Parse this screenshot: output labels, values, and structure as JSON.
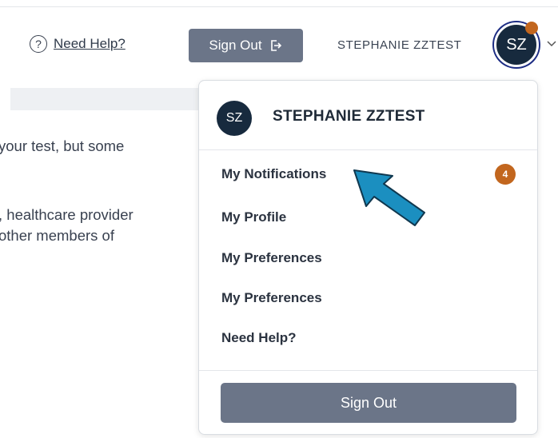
{
  "header": {
    "help_icon": "question-circle-icon",
    "help_label": "Need Help?",
    "signout_label": "Sign Out",
    "signout_icon": "sign-out-icon",
    "user_name": "STEPHANIE ZZTEST",
    "avatar_initials": "SZ",
    "avatar_notification_color": "#c2661e",
    "chevron_icon": "chevron-down-icon"
  },
  "background": {
    "lines": [
      "your test, but some",
      ", healthcare provider",
      "other members of"
    ]
  },
  "dropdown": {
    "avatar_initials": "SZ",
    "user_name": "STEPHANIE ZZTEST",
    "items": [
      {
        "label": "My Notifications",
        "badge": "4"
      },
      {
        "label": "My Profile"
      },
      {
        "label": "My Preferences"
      },
      {
        "label": "My Preferences"
      },
      {
        "label": "Need Help?"
      }
    ],
    "signout_label": "Sign Out"
  },
  "annotation": {
    "arrow_color": "#1b8fc0",
    "arrow_icon": "pointer-arrow-icon"
  }
}
